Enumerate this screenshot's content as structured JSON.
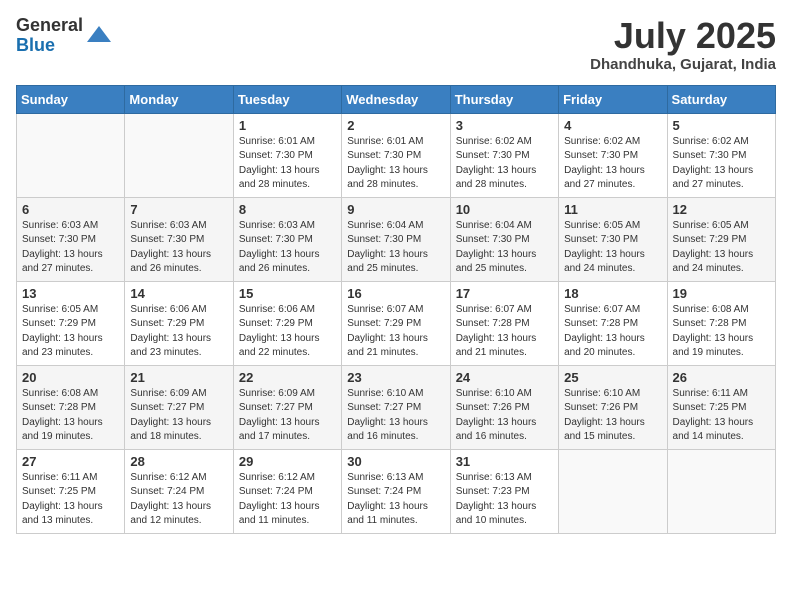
{
  "logo": {
    "general": "General",
    "blue": "Blue"
  },
  "header": {
    "month_year": "July 2025",
    "location": "Dhandhuka, Gujarat, India"
  },
  "days_of_week": [
    "Sunday",
    "Monday",
    "Tuesday",
    "Wednesday",
    "Thursday",
    "Friday",
    "Saturday"
  ],
  "weeks": [
    [
      {
        "day": "",
        "info": ""
      },
      {
        "day": "",
        "info": ""
      },
      {
        "day": "1",
        "info": "Sunrise: 6:01 AM\nSunset: 7:30 PM\nDaylight: 13 hours and 28 minutes."
      },
      {
        "day": "2",
        "info": "Sunrise: 6:01 AM\nSunset: 7:30 PM\nDaylight: 13 hours and 28 minutes."
      },
      {
        "day": "3",
        "info": "Sunrise: 6:02 AM\nSunset: 7:30 PM\nDaylight: 13 hours and 28 minutes."
      },
      {
        "day": "4",
        "info": "Sunrise: 6:02 AM\nSunset: 7:30 PM\nDaylight: 13 hours and 27 minutes."
      },
      {
        "day": "5",
        "info": "Sunrise: 6:02 AM\nSunset: 7:30 PM\nDaylight: 13 hours and 27 minutes."
      }
    ],
    [
      {
        "day": "6",
        "info": "Sunrise: 6:03 AM\nSunset: 7:30 PM\nDaylight: 13 hours and 27 minutes."
      },
      {
        "day": "7",
        "info": "Sunrise: 6:03 AM\nSunset: 7:30 PM\nDaylight: 13 hours and 26 minutes."
      },
      {
        "day": "8",
        "info": "Sunrise: 6:03 AM\nSunset: 7:30 PM\nDaylight: 13 hours and 26 minutes."
      },
      {
        "day": "9",
        "info": "Sunrise: 6:04 AM\nSunset: 7:30 PM\nDaylight: 13 hours and 25 minutes."
      },
      {
        "day": "10",
        "info": "Sunrise: 6:04 AM\nSunset: 7:30 PM\nDaylight: 13 hours and 25 minutes."
      },
      {
        "day": "11",
        "info": "Sunrise: 6:05 AM\nSunset: 7:30 PM\nDaylight: 13 hours and 24 minutes."
      },
      {
        "day": "12",
        "info": "Sunrise: 6:05 AM\nSunset: 7:29 PM\nDaylight: 13 hours and 24 minutes."
      }
    ],
    [
      {
        "day": "13",
        "info": "Sunrise: 6:05 AM\nSunset: 7:29 PM\nDaylight: 13 hours and 23 minutes."
      },
      {
        "day": "14",
        "info": "Sunrise: 6:06 AM\nSunset: 7:29 PM\nDaylight: 13 hours and 23 minutes."
      },
      {
        "day": "15",
        "info": "Sunrise: 6:06 AM\nSunset: 7:29 PM\nDaylight: 13 hours and 22 minutes."
      },
      {
        "day": "16",
        "info": "Sunrise: 6:07 AM\nSunset: 7:29 PM\nDaylight: 13 hours and 21 minutes."
      },
      {
        "day": "17",
        "info": "Sunrise: 6:07 AM\nSunset: 7:28 PM\nDaylight: 13 hours and 21 minutes."
      },
      {
        "day": "18",
        "info": "Sunrise: 6:07 AM\nSunset: 7:28 PM\nDaylight: 13 hours and 20 minutes."
      },
      {
        "day": "19",
        "info": "Sunrise: 6:08 AM\nSunset: 7:28 PM\nDaylight: 13 hours and 19 minutes."
      }
    ],
    [
      {
        "day": "20",
        "info": "Sunrise: 6:08 AM\nSunset: 7:28 PM\nDaylight: 13 hours and 19 minutes."
      },
      {
        "day": "21",
        "info": "Sunrise: 6:09 AM\nSunset: 7:27 PM\nDaylight: 13 hours and 18 minutes."
      },
      {
        "day": "22",
        "info": "Sunrise: 6:09 AM\nSunset: 7:27 PM\nDaylight: 13 hours and 17 minutes."
      },
      {
        "day": "23",
        "info": "Sunrise: 6:10 AM\nSunset: 7:27 PM\nDaylight: 13 hours and 16 minutes."
      },
      {
        "day": "24",
        "info": "Sunrise: 6:10 AM\nSunset: 7:26 PM\nDaylight: 13 hours and 16 minutes."
      },
      {
        "day": "25",
        "info": "Sunrise: 6:10 AM\nSunset: 7:26 PM\nDaylight: 13 hours and 15 minutes."
      },
      {
        "day": "26",
        "info": "Sunrise: 6:11 AM\nSunset: 7:25 PM\nDaylight: 13 hours and 14 minutes."
      }
    ],
    [
      {
        "day": "27",
        "info": "Sunrise: 6:11 AM\nSunset: 7:25 PM\nDaylight: 13 hours and 13 minutes."
      },
      {
        "day": "28",
        "info": "Sunrise: 6:12 AM\nSunset: 7:24 PM\nDaylight: 13 hours and 12 minutes."
      },
      {
        "day": "29",
        "info": "Sunrise: 6:12 AM\nSunset: 7:24 PM\nDaylight: 13 hours and 11 minutes."
      },
      {
        "day": "30",
        "info": "Sunrise: 6:13 AM\nSunset: 7:24 PM\nDaylight: 13 hours and 11 minutes."
      },
      {
        "day": "31",
        "info": "Sunrise: 6:13 AM\nSunset: 7:23 PM\nDaylight: 13 hours and 10 minutes."
      },
      {
        "day": "",
        "info": ""
      },
      {
        "day": "",
        "info": ""
      }
    ]
  ]
}
